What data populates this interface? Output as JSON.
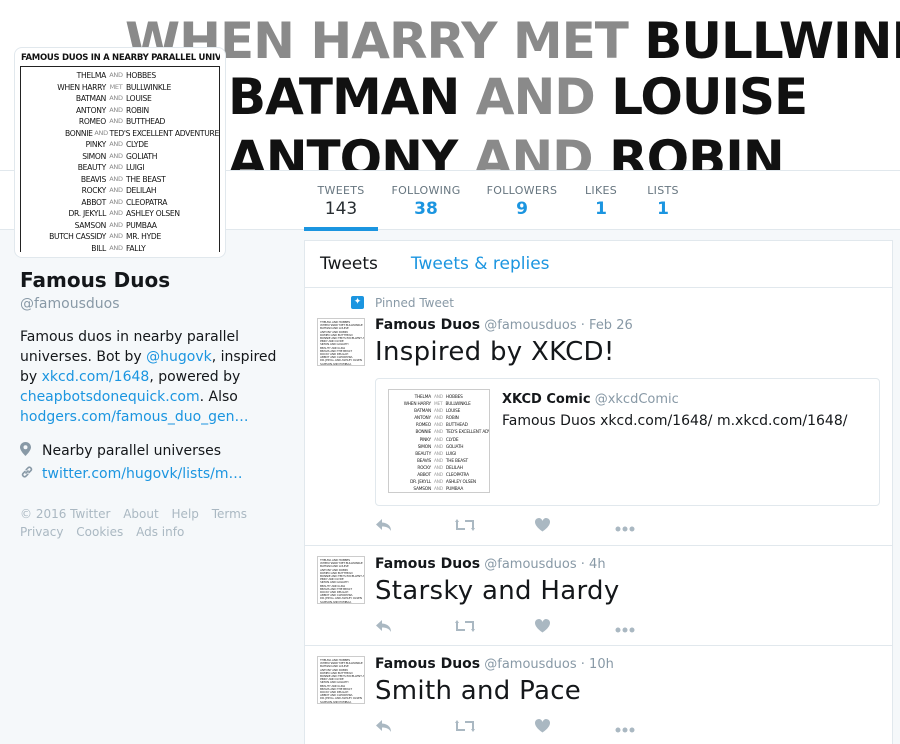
{
  "banner": {
    "lines": [
      {
        "a": "WHEN HARRY",
        "mid": "MET",
        "b": "BULLWINKLE"
      },
      {
        "a": "BATMAN",
        "mid": "AND",
        "b": "LOUISE"
      },
      {
        "a": "ANTONY",
        "mid": "AND",
        "b": "ROBIN"
      }
    ]
  },
  "avatar": {
    "title": "FAMOUS DUOS IN A NEARBY PARALLEL UNIVERSE",
    "rows": [
      {
        "l": "THELMA",
        "m": "AND",
        "r": "HOBBES"
      },
      {
        "l": "WHEN HARRY",
        "m": "MET",
        "r": "BULLWINKLE"
      },
      {
        "l": "BATMAN",
        "m": "AND",
        "r": "LOUISE"
      },
      {
        "l": "ANTONY",
        "m": "AND",
        "r": "ROBIN"
      },
      {
        "l": "ROMEO",
        "m": "AND",
        "r": "BUTTHEAD"
      },
      {
        "l": "BONNIE",
        "m": "AND",
        "r": "TED'S EXCELLENT ADVENTURE"
      },
      {
        "l": "PINKY",
        "m": "AND",
        "r": "CLYDE"
      },
      {
        "l": "SIMON",
        "m": "AND",
        "r": "GOLIATH"
      },
      {
        "l": "BEAUTY",
        "m": "AND",
        "r": "LUIGI"
      },
      {
        "l": "BEAVIS",
        "m": "AND",
        "r": "THE BEAST"
      },
      {
        "l": "ROCKY",
        "m": "AND",
        "r": "DELILAH"
      },
      {
        "l": "ABBOT",
        "m": "AND",
        "r": "CLEOPATRA"
      },
      {
        "l": "DR. JEKYLL",
        "m": "AND",
        "r": "ASHLEY OLSEN"
      },
      {
        "l": "SAMSON",
        "m": "AND",
        "r": "PUMBAA"
      },
      {
        "l": "BUTCH CASSIDY",
        "m": "AND",
        "r": "MR. HYDE"
      },
      {
        "l": "BILL",
        "m": "AND",
        "r": "FALLY"
      }
    ]
  },
  "nav": {
    "tweets": {
      "label": "TWEETS",
      "value": "143"
    },
    "following": {
      "label": "FOLLOWING",
      "value": "38"
    },
    "followers": {
      "label": "FOLLOWERS",
      "value": "9"
    },
    "likes": {
      "label": "LIKES",
      "value": "1"
    },
    "lists": {
      "label": "LISTS",
      "value": "1"
    }
  },
  "profile": {
    "name": "Famous Duos",
    "handle": "@famousduos",
    "bio_1": "Famous duos in nearby parallel universes. Bot by ",
    "bio_link_1": "@hugovk",
    "bio_2": ", inspired by ",
    "bio_link_2": "xkcd.com/1648",
    "bio_3": ", powered by ",
    "bio_link_3": "cheapbotsdonequick.com",
    "bio_4": ". Also ",
    "bio_link_4": "hodgers.com/famous_duo_gen…",
    "location": "Nearby parallel universes",
    "url": "twitter.com/hugovk/lists/m…",
    "footer": [
      "© 2016 Twitter",
      "About",
      "Help",
      "Terms",
      "Privacy",
      "Cookies",
      "Ads info"
    ]
  },
  "timeline": {
    "tab_tweets": "Tweets",
    "tab_replies": "Tweets & replies",
    "pinned_label": "Pinned Tweet",
    "tweets": [
      {
        "name": "Famous Duos",
        "handle": "@famousduos",
        "time": "· Feb 26",
        "text": "Inspired by XKCD!"
      },
      {
        "name": "Famous Duos",
        "handle": "@famousduos",
        "time": "· 4h",
        "text": "Starsky and Hardy"
      },
      {
        "name": "Famous Duos",
        "handle": "@famousduos",
        "time": "· 10h",
        "text": "Smith and Pace"
      }
    ],
    "card": {
      "name": "XKCD Comic",
      "handle": "@xkcdComic",
      "text": "Famous Duos xkcd.com/1648/ m.xkcd.com/1648/"
    }
  },
  "icons": {
    "reply": "reply-icon",
    "retweet": "retweet-icon",
    "like": "heart-icon",
    "more": "more-icon",
    "location": "location-icon",
    "link": "link-icon",
    "pin": "pin-icon"
  },
  "colors": {
    "accent": "#1b95e0",
    "muted": "#8899a6",
    "text": "#14171a"
  }
}
